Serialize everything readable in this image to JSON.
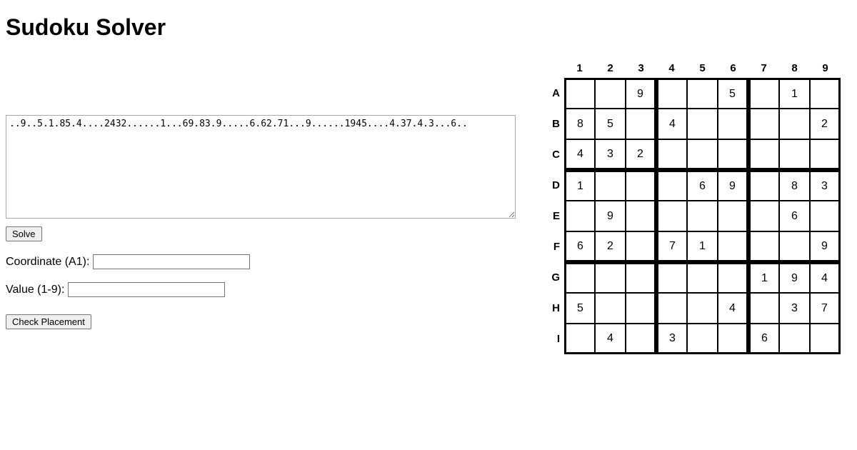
{
  "title": "Sudoku Solver",
  "puzzle_textarea_value": "..9..5.1.85.4....2432......1...69.83.9.....6.62.71...9......1945....4.37.4.3...6..",
  "solve_button_label": "Solve",
  "coordinate_label": "Coordinate (A1):",
  "coordinate_value": "",
  "value_label": "Value (1-9):",
  "value_value": "",
  "check_button_label": "Check Placement",
  "grid": {
    "col_labels": [
      "1",
      "2",
      "3",
      "4",
      "5",
      "6",
      "7",
      "8",
      "9"
    ],
    "row_labels": [
      "A",
      "B",
      "C",
      "D",
      "E",
      "F",
      "G",
      "H",
      "I"
    ],
    "cells": [
      [
        "",
        "",
        "9",
        "",
        "",
        "5",
        "",
        "1",
        ""
      ],
      [
        "8",
        "5",
        "",
        "4",
        "",
        "",
        "",
        "",
        "2"
      ],
      [
        "4",
        "3",
        "2",
        "",
        "",
        "",
        "",
        "",
        ""
      ],
      [
        "1",
        "",
        "",
        "",
        "6",
        "9",
        "",
        "8",
        "3"
      ],
      [
        "",
        "9",
        "",
        "",
        "",
        "",
        "",
        "6",
        ""
      ],
      [
        "6",
        "2",
        "",
        "7",
        "1",
        "",
        "",
        "",
        "9"
      ],
      [
        "",
        "",
        "",
        "",
        "",
        "",
        "1",
        "9",
        "4"
      ],
      [
        "5",
        "",
        "",
        "",
        "",
        "4",
        "",
        "3",
        "7"
      ],
      [
        "",
        "4",
        "",
        "3",
        "",
        "",
        "6",
        "",
        ""
      ]
    ]
  }
}
